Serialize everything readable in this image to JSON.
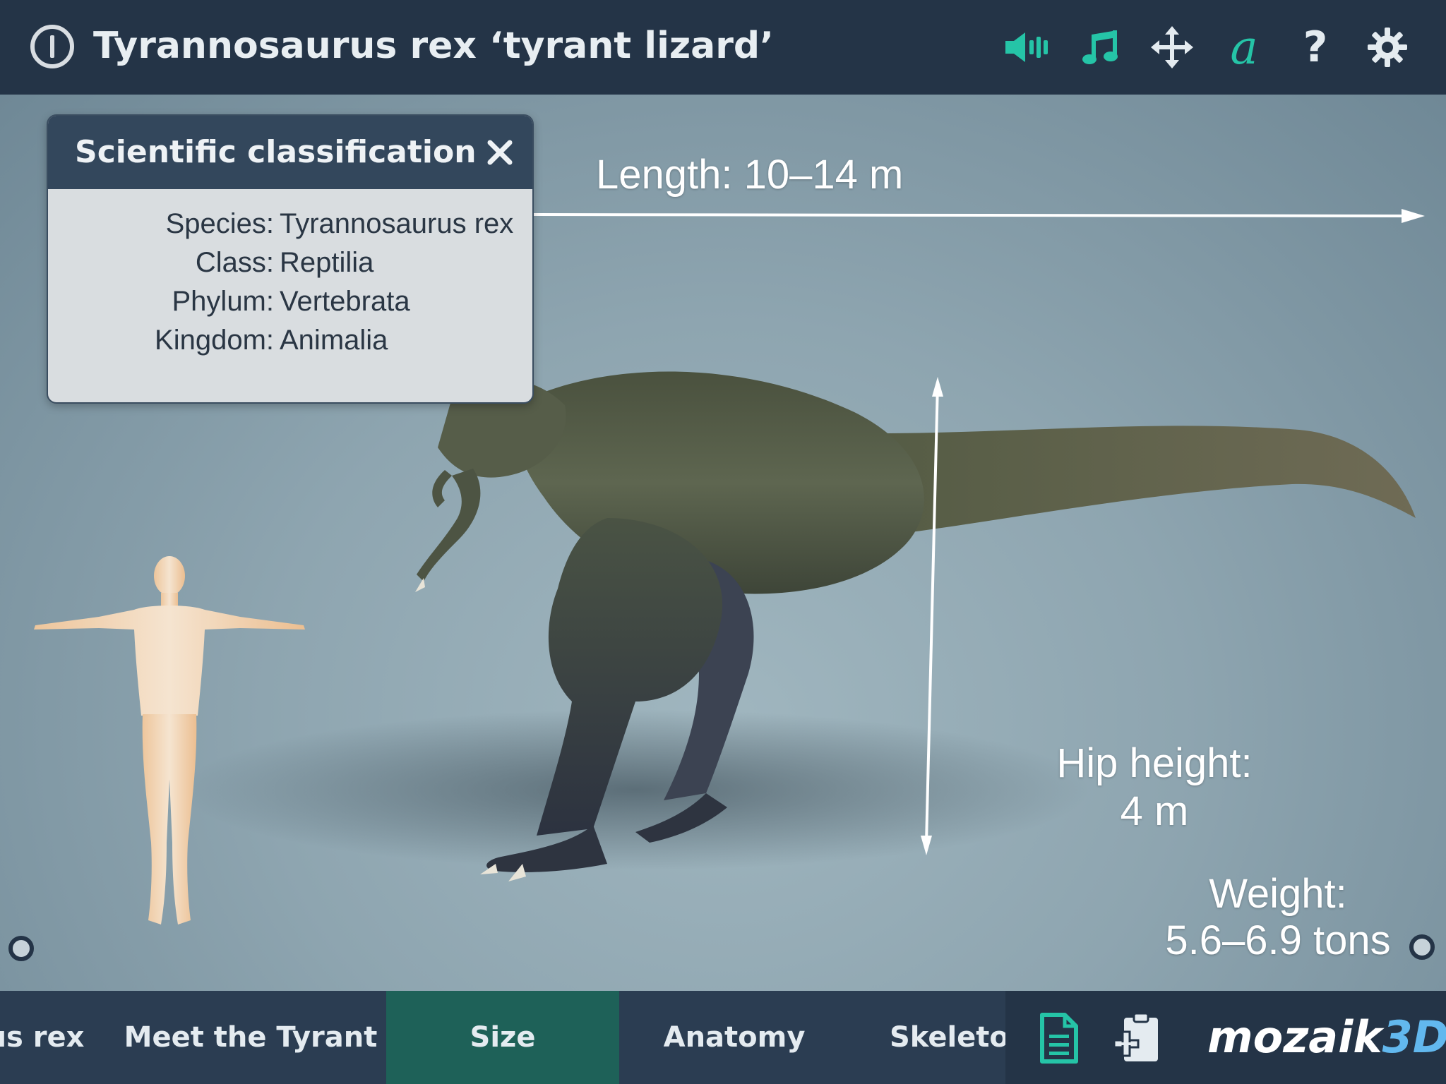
{
  "header": {
    "title": "Tyrannosaurus rex ‘tyrant lizard’",
    "icons": [
      "power-icon",
      "speaker-icon",
      "music-note-icon",
      "move-icon",
      "text-a-icon",
      "help-icon",
      "gear-icon"
    ],
    "accent_color": "#25c4a7"
  },
  "classification": {
    "title": "Scientific classification",
    "close": "✕",
    "rows": [
      {
        "label": "Species:",
        "value": "Tyrannosaurus rex"
      },
      {
        "label": "Class:",
        "value": "Reptilia"
      },
      {
        "label": "Phylum:",
        "value": "Vertebrata"
      },
      {
        "label": "Kingdom:",
        "value": "Animalia"
      }
    ]
  },
  "measurements": {
    "length": "Length: 10–14 m",
    "hip_label": "Hip height:",
    "hip_value": "4 m",
    "weight_label": "Weight:",
    "weight_value": "5.6–6.9 tons"
  },
  "tabs": [
    {
      "label": "us rex",
      "active": false
    },
    {
      "label": "Meet the Tyrant",
      "active": false
    },
    {
      "label": "Size",
      "active": true
    },
    {
      "label": "Anatomy",
      "active": false
    },
    {
      "label": "Skeleto",
      "active": false
    }
  ],
  "footer": {
    "icons": [
      "document-icon",
      "add-to-clipboard-icon"
    ],
    "brand_part1": "mozaik",
    "brand_part2": "3D",
    "brand_accent": "#62b8ee"
  }
}
